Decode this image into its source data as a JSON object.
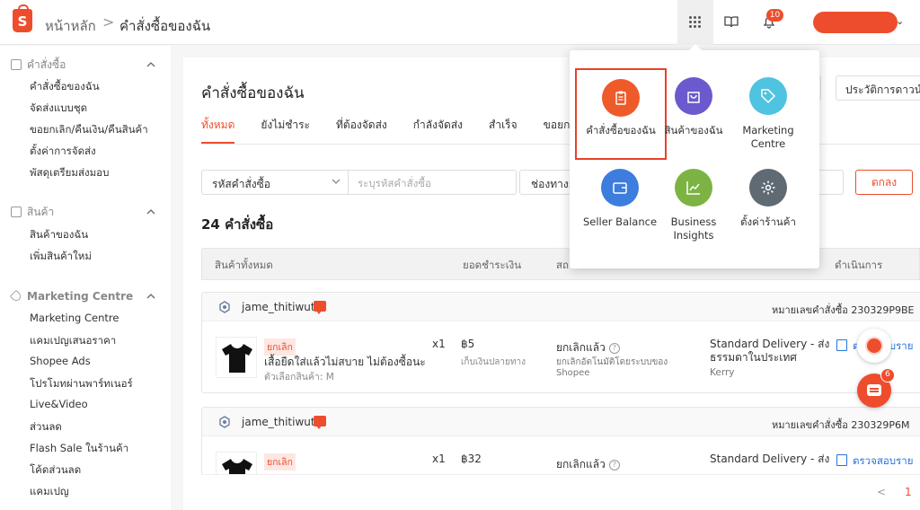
{
  "colors": {
    "brand": "#ee4d2d",
    "link": "#2673dd"
  },
  "topbar": {
    "logo_letter": "S",
    "breadcrumb_home": "หน้าหลัก",
    "breadcrumb_sep": ">",
    "breadcrumb_current": "คำสั่งซื้อของฉัน",
    "notification_count": "10",
    "icons": [
      "apps-grid-icon",
      "book-icon",
      "bell-icon"
    ]
  },
  "sidebar": {
    "sections": [
      {
        "title": "คำสั่งซื้อ",
        "icon": "clipboard-icon",
        "items": [
          "คำสั่งซื้อของฉัน",
          "จัดส่งแบบชุด",
          "ขอยกเลิก/คืนเงิน/คืนสินค้า",
          "ตั้งค่าการจัดส่ง",
          "พัสดุเตรียมส่งมอบ"
        ]
      },
      {
        "title": "สินค้า",
        "icon": "box-icon",
        "items": [
          "สินค้าของฉัน",
          "เพิ่มสินค้าใหม่"
        ]
      },
      {
        "title": "Marketing Centre",
        "icon": "tag-icon",
        "items": [
          "Marketing Centre",
          "แคมเปญเสนอราคา",
          "Shopee Ads",
          "โปรโมทผ่านพาร์ทเนอร์",
          "Live&Video",
          "ส่วนลด",
          "Flash Sale ในร้านค้า",
          "โค้ดส่วนลด",
          "แคมเปญ"
        ]
      }
    ]
  },
  "main": {
    "title": "คำสั่งซื้อของฉัน",
    "rating_button": "ประวัติการดาวน์โหลด",
    "tabs": [
      "ทั้งหมด",
      "ยังไม่ชำระ",
      "ที่ต้องจัดส่ง",
      "กำลังจัดส่ง",
      "สำเร็จ",
      "ขอยกเลิก"
    ],
    "search": {
      "type_label": "รหัสคำสั่งซื้อ",
      "placeholder": "ระบุรหัสคำสั่งซื้อ",
      "channel_label": "ช่องทางการจัดส่ง",
      "ok_label": "ตกลง"
    },
    "count_label": "24 คำสั่งซื้อ",
    "table_headers": {
      "product": "สินค้าทั้งหมด",
      "total": "ยอดชำระเงิน",
      "status": "สถานะ",
      "action": "ดำเนินการ"
    },
    "orders": [
      {
        "buyer": "jame_thitiwut",
        "order_no": "หมายเลขคำสั่งซื้อ 230329P9BE",
        "tag": "ยกเลิก",
        "product_name": "เสื้อยืดใส่แล้วไม่สบาย ไม่ต้องซื้อนะ",
        "variant": "ตัวเลือกสินค้า: M",
        "qty": "x1",
        "price": "฿5",
        "payment": "เก็บเงินปลายทาง",
        "status": "ยกเลิกแล้ว",
        "status_sub": "ยกเลิกอัตโนมัติโดยระบบของ Shopee",
        "shipping": "Standard Delivery - ส่งธรรมดาในประเทศ",
        "carrier": "Kerry",
        "action": "ตรวจสอบราย"
      },
      {
        "buyer": "jame_thitiwut",
        "order_no": "หมายเลขคำสั่งซื้อ 230329P6M",
        "tag": "ยกเลิก",
        "product_name": "",
        "variant": "",
        "qty": "x1",
        "price": "฿32",
        "payment": "",
        "status": "ยกเลิกแล้ว",
        "status_sub": "",
        "shipping": "Standard Delivery - ส่ง",
        "carrier": "",
        "action": "ตรวจสอบราย"
      }
    ],
    "pager": {
      "prev": "<",
      "page": "1"
    }
  },
  "apps_popup": {
    "apps": [
      {
        "label": "คำสั่งซื้อของฉัน",
        "icon": "clipboard-icon",
        "color": "#ee5a2a",
        "highlighted": true
      },
      {
        "label": "สินค้าของฉัน",
        "icon": "shopping-bag-icon",
        "color": "#6a5acd"
      },
      {
        "label": "Marketing Centre",
        "icon": "tag-icon",
        "color": "#4fc3e0"
      },
      {
        "label": "Seller Balance",
        "icon": "wallet-icon",
        "color": "#3c7ddd"
      },
      {
        "label": "Business Insights",
        "icon": "chart-line-icon",
        "color": "#7cb342"
      },
      {
        "label": "ตั้งค่าร้านค้า",
        "icon": "gear-icon",
        "color": "#5f6a73"
      }
    ]
  },
  "floating": {
    "chat_badge": "6"
  }
}
